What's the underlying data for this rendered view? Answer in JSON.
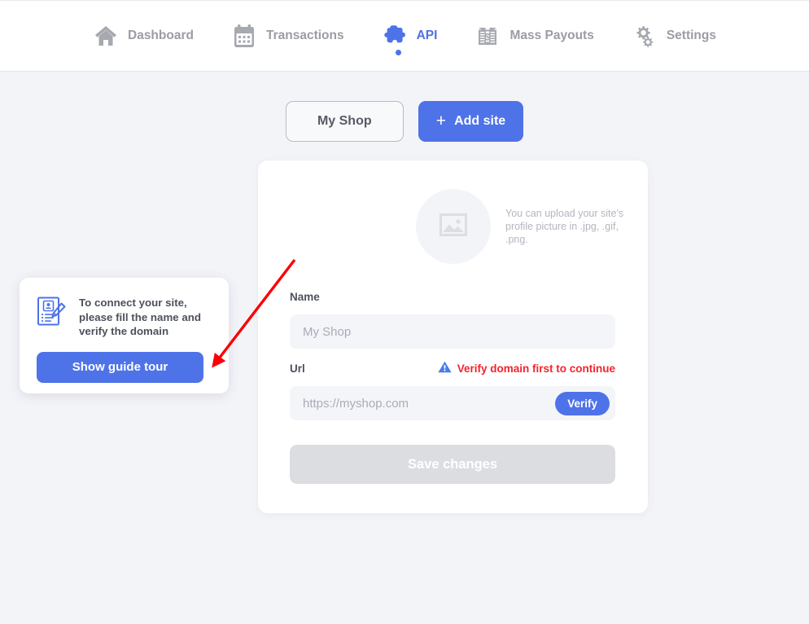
{
  "nav": {
    "items": [
      {
        "label": "Dashboard",
        "icon": "home-icon",
        "active": false
      },
      {
        "label": "Transactions",
        "icon": "calendar-icon",
        "active": false
      },
      {
        "label": "API",
        "icon": "puzzle-piece-icon",
        "active": true
      },
      {
        "label": "Mass Payouts",
        "icon": "money-stack-icon",
        "active": false
      },
      {
        "label": "Settings",
        "icon": "gears-icon",
        "active": false
      }
    ]
  },
  "site_row": {
    "site_tab_label": "My Shop",
    "add_site_label": "Add site",
    "add_site_plus": "+"
  },
  "card": {
    "upload": {
      "hint": "You can upload your site's profile picture in .jpg, .gif, .png.",
      "placeholder_icon": "image-placeholder-icon"
    },
    "name_field": {
      "label": "Name",
      "value": "",
      "placeholder": "My Shop"
    },
    "url_field": {
      "label": "Url",
      "value": "",
      "placeholder": "https://myshop.com",
      "verify_label": "Verify",
      "error_text": "Verify domain first to continue",
      "error_icon": "warning-triangle-icon"
    },
    "save_label": "Save changes"
  },
  "guide_popup": {
    "icon": "document-person-pencil-icon",
    "text": "To connect your site, please fill the name and verify the domain",
    "button_label": "Show guide tour"
  },
  "annotation": {
    "arrow_color": "#fb0007"
  },
  "colors": {
    "accent": "#4e72e8",
    "background": "#f3f4f8",
    "error": "#f5222d",
    "muted_text": "#9b9da4",
    "disabled_button": "#dcdde1"
  }
}
